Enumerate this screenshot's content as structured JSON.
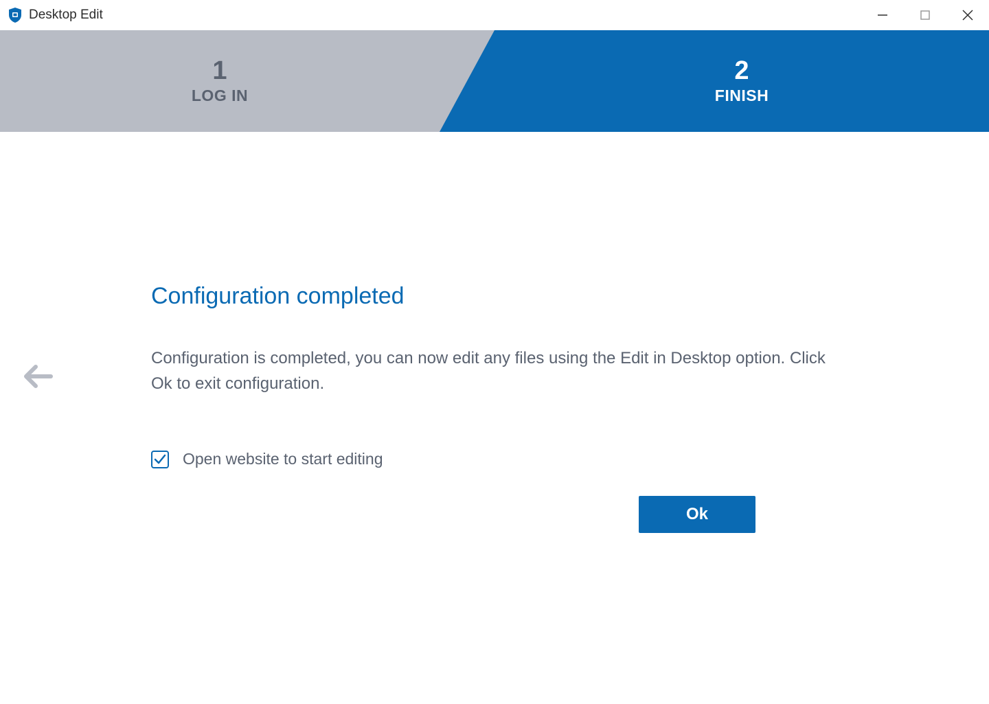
{
  "titlebar": {
    "app_title": "Desktop Edit"
  },
  "stepper": {
    "step1": {
      "number": "1",
      "label": "LOG IN"
    },
    "step2": {
      "number": "2",
      "label": "FINISH"
    }
  },
  "content": {
    "heading": "Configuration completed",
    "body": "Configuration is completed, you can now edit any files using the Edit in Desktop option. Click Ok to exit configuration.",
    "checkbox_label": "Open website to start editing",
    "checkbox_checked": true,
    "ok_button": "Ok"
  },
  "colors": {
    "accent": "#0a6ab3",
    "muted_bg": "#b8bcc5",
    "text_muted": "#5a6270"
  }
}
